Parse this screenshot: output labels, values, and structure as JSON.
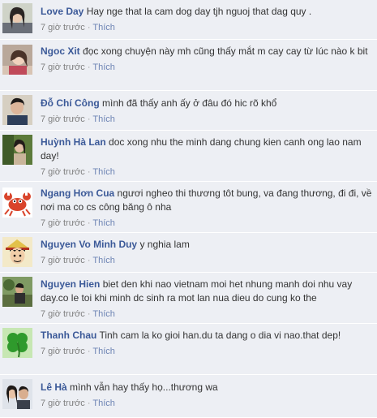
{
  "comments": [
    {
      "author": "Love Day",
      "text": "Hay nge that la cam dog day tjh nguoj that dag quy .",
      "time": "7 giờ trước",
      "sep": "·",
      "like": "Thích",
      "avatar": "avatar-girl-icon"
    },
    {
      "author": "Ngoc Xit",
      "text": "đọc xong chuyện này mh cũng thấy mắt m cay cay từ lúc nào k bit",
      "time": "7 giờ trước",
      "sep": "·",
      "like": "Thích",
      "avatar": "avatar-girl-icon"
    },
    {
      "author": "Đỗ Chí Công",
      "text": "mình đã thấy anh ấy ở đâu đó hic rõ khổ",
      "time": "7 giờ trước",
      "sep": "·",
      "like": "Thích",
      "avatar": "avatar-boy-icon"
    },
    {
      "author": "Huỳnh Hà Lan",
      "text": "doc xong nhu the minh dang chung kien canh ong lao nam day!",
      "time": "7 giờ trước",
      "sep": "·",
      "like": "Thích",
      "avatar": "avatar-girl-outdoor-icon"
    },
    {
      "author": "Ngang Hơn Cua",
      "text": "ngươi ngheo thi thương tôt bung, va đang thương, đi đi, về nơi ma co cs công băng ô nha",
      "time": "7 giờ trước",
      "sep": "·",
      "like": "Thích",
      "avatar": "crab-icon"
    },
    {
      "author": "Nguyen Vo Minh Duy",
      "text": "y nghia lam",
      "time": "7 giờ trước",
      "sep": "·",
      "like": "Thích",
      "avatar": "avatar-anime-icon"
    },
    {
      "author": "Nguyen Hien",
      "text": "biet den khi nao vietnam moi het nhung manh doi nhu vay day.co le toi khi minh dc sinh ra mot lan nua dieu do cung ko the",
      "time": "7 giờ trước",
      "sep": "·",
      "like": "Thích",
      "avatar": "avatar-outdoor-icon"
    },
    {
      "author": "Thanh Chau",
      "text": "Tinh cam la ko gioi han.du ta dang o dia vi nao.that dep!",
      "time": "7 giờ trước",
      "sep": "·",
      "like": "Thích",
      "avatar": "clover-icon"
    },
    {
      "author": "Lê Hà",
      "text": "mình vẫn hay thấy họ...thương wa",
      "time": "7 giờ trước",
      "sep": "·",
      "like": "Thích",
      "avatar": "avatar-couple-icon"
    }
  ]
}
